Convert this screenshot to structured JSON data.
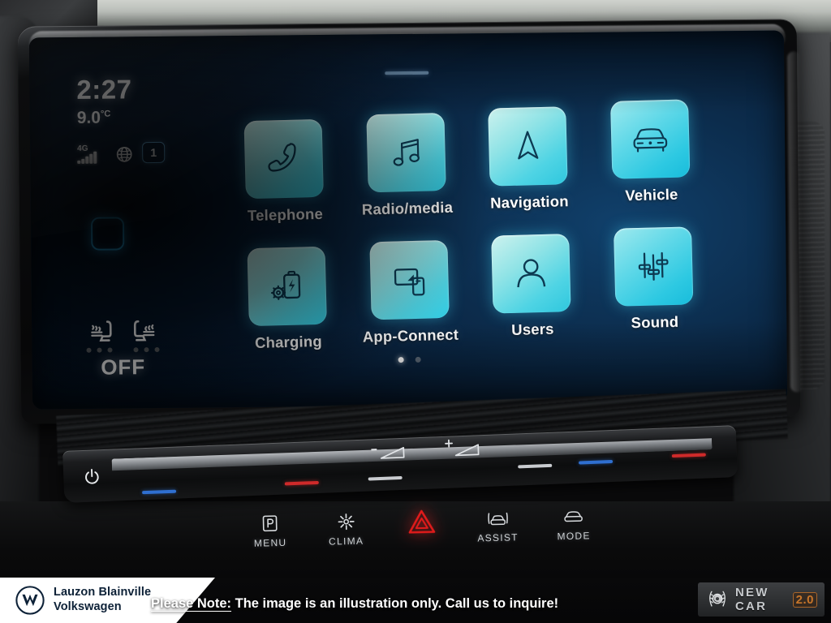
{
  "status": {
    "time": "2:27",
    "temperature": "9.0",
    "temperature_unit": "°C",
    "network_label": "4G",
    "signal_bars": 5,
    "sim_badge": "1",
    "globe_icon": "globe-icon"
  },
  "climate": {
    "seat_heating_state": "OFF",
    "left_seat_icon": "seat-heating-left-icon",
    "right_seat_icon": "seat-heating-right-icon",
    "level_dots": 3
  },
  "home": {
    "page_dots": [
      true,
      false
    ],
    "apps": [
      {
        "label": "Telephone",
        "icon": "phone-handset-icon",
        "bright": false
      },
      {
        "label": "Radio/media",
        "icon": "music-note-icon",
        "bright": false
      },
      {
        "label": "Navigation",
        "icon": "navigation-arrow-icon",
        "bright": false
      },
      {
        "label": "Vehicle",
        "icon": "car-front-icon",
        "bright": true
      },
      {
        "label": "Charging",
        "icon": "battery-charging-gear-icon",
        "bright": false
      },
      {
        "label": "App-Connect",
        "icon": "screen-phone-icon",
        "bright": false
      },
      {
        "label": "Users",
        "icon": "person-icon",
        "bright": false
      },
      {
        "label": "Sound",
        "icon": "equalizer-sliders-icon",
        "bright": true
      }
    ]
  },
  "console": {
    "power_icon": "power-icon",
    "volume_down_icon": "volume-decrease-icon",
    "volume_up_icon": "volume-increase-icon",
    "temp_marks": [
      "blue",
      "red",
      "white",
      "white",
      "blue",
      "red"
    ],
    "buttons": [
      {
        "label": "MENU",
        "icon": "park-menu-icon"
      },
      {
        "label": "CLIMA",
        "icon": "climate-fan-icon"
      },
      {
        "label": "",
        "icon": "hazard-triangle-icon"
      },
      {
        "label": "ASSIST",
        "icon": "driver-assist-icon"
      },
      {
        "label": "MODE",
        "icon": "drive-mode-icon"
      }
    ]
  },
  "footer": {
    "dealer_line1": "Lauzon Blainville",
    "dealer_line2": "Volkswagen",
    "logo_icon": "vw-roundel-icon",
    "note_prefix": "Please Note:",
    "note_text": " The image is an illustration only. Call us to inquire!",
    "badge_emblem": "laurel-shutter-emblem-icon",
    "badge_text": "NEW CAR",
    "badge_version": "2.0"
  },
  "colors": {
    "tile_accent": "#2ec9e2",
    "tile_icon": "#0d3a52",
    "home_key_glow": "#29b6f6",
    "hazard_red": "#e01b1b",
    "brand_navy": "#0d2137",
    "badge_orange": "#c8762a"
  }
}
